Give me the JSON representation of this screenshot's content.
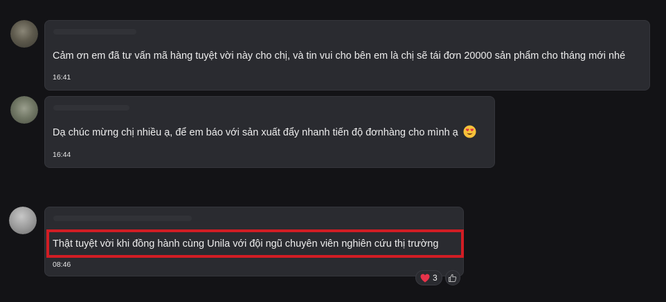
{
  "messages": [
    {
      "text": "Cảm ơn em đã tư vấn mã hàng tuyệt vời này cho chị, và tin vui cho bên em là chị sẽ tái đơn 20000 sản phẩm cho tháng mới nhé",
      "time": "16:41"
    },
    {
      "text": "Dạ chúc mừng chị nhiều ạ, để em báo với sản xuất đẩy nhanh tiến độ đơnhàng cho mình ạ",
      "emoji": "heart-eyes-emoji",
      "time": "16:44"
    },
    {
      "text": "Thật tuyệt vời khi đồng hành cùng Unila với đội ngũ chuyên viên nghiên cứu thị trường",
      "time": "08:46",
      "highlighted": true,
      "reactions": {
        "heart_icon": "heart-icon",
        "count": "3",
        "like_icon": "thumbs-up-icon"
      }
    }
  ],
  "colors": {
    "background": "#131316",
    "bubble": "#2a2b30",
    "highlight": "#d21d24",
    "heart": "#e8334a",
    "emoji_face": "#f7c13a"
  }
}
